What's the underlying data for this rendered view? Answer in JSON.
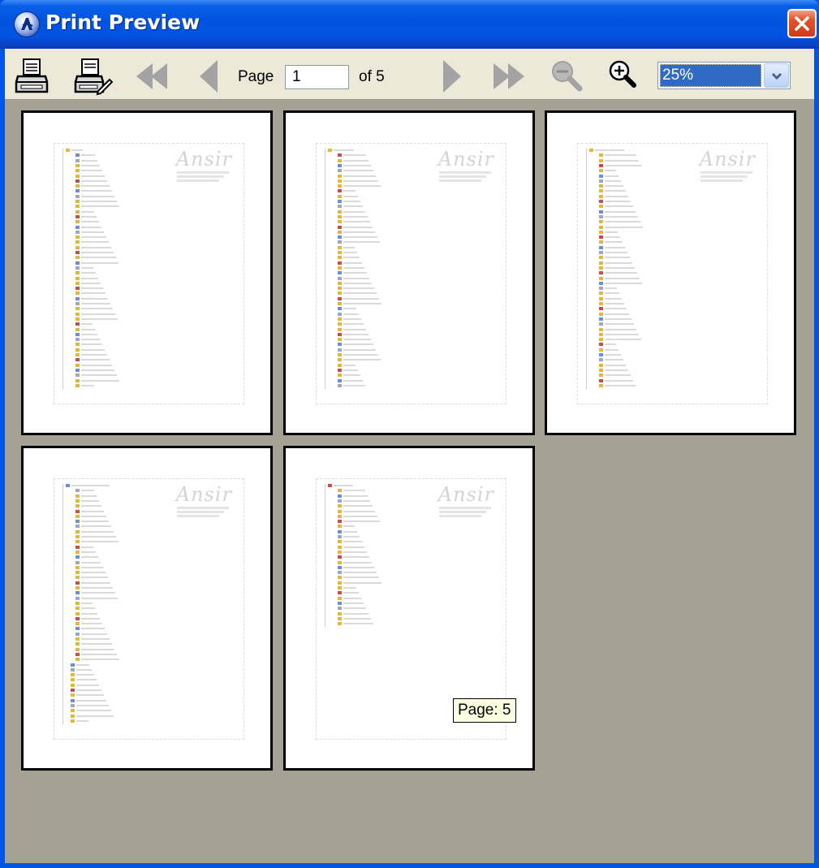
{
  "window": {
    "title": "Print Preview",
    "colors": {
      "titlebar": "#0254df",
      "client": "#a5a195",
      "toolbar": "#ece9d8",
      "close": "#e5532d"
    }
  },
  "toolbar": {
    "buttons": [
      {
        "name": "print-button",
        "icon": "printer-icon",
        "enabled": true
      },
      {
        "name": "print-setup-button",
        "icon": "printer-edit-icon",
        "enabled": true
      },
      {
        "name": "first-page-button",
        "icon": "first-page-icon",
        "enabled": false
      },
      {
        "name": "previous-page-button",
        "icon": "previous-page-icon",
        "enabled": false
      },
      {
        "name": "next-page-button",
        "icon": "next-page-icon",
        "enabled": false
      },
      {
        "name": "last-page-button",
        "icon": "last-page-icon",
        "enabled": false
      },
      {
        "name": "zoom-out-button",
        "icon": "zoom-out-icon",
        "enabled": false
      },
      {
        "name": "zoom-in-button",
        "icon": "zoom-in-icon",
        "enabled": true
      }
    ],
    "page_label": "Page",
    "page_value": "1",
    "of_label": "of 5",
    "zoom": "25%"
  },
  "pages": [
    {
      "index": 1,
      "entries": 47,
      "watermark": "Ansir"
    },
    {
      "index": 2,
      "entries": 47,
      "watermark": "Ansir"
    },
    {
      "index": 3,
      "entries": 47,
      "watermark": "Ansir"
    },
    {
      "index": 4,
      "entries": 47,
      "watermark": "Ansir"
    },
    {
      "index": 5,
      "entries": 28,
      "watermark": "Ansir"
    }
  ],
  "tooltip": "Page: 5"
}
